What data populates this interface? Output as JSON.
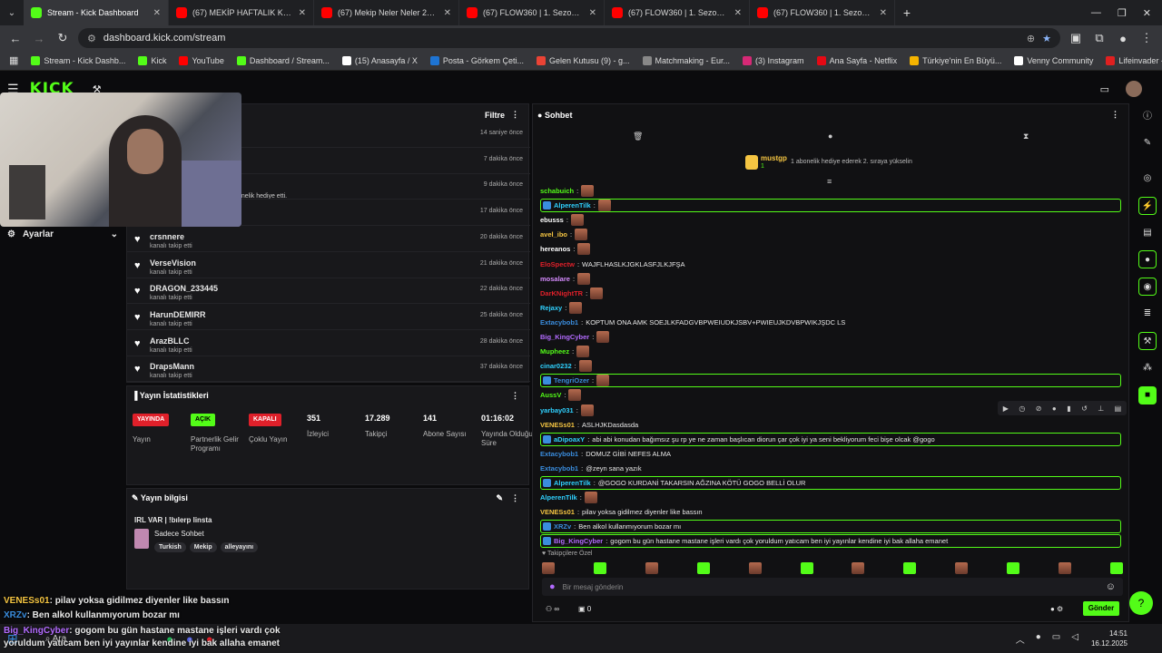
{
  "browser": {
    "tabs": [
      {
        "title": "Stream - Kick Dashboard",
        "color": "#53fc18"
      },
      {
        "title": "(67) MEKİP HAFTALIK KOMİK AN",
        "color": "#ff0000"
      },
      {
        "title": "(67) Mekip Neler Neler 26.bölü",
        "color": "#ff0000"
      },
      {
        "title": "(67) FLOW360 | 1. Sezon 6. Bölü",
        "color": "#ff0000"
      },
      {
        "title": "(67) FLOW360 | 1. Sezon 7. Bölü",
        "color": "#ff0000"
      },
      {
        "title": "(67) FLOW360 | 1. Sezon 8. Bölü",
        "color": "#ff0000"
      }
    ],
    "url": "dashboard.kick.com/stream",
    "bookmarks": [
      {
        "label": "Stream - Kick Dashb...",
        "color": "#53fc18"
      },
      {
        "label": "Kick",
        "color": "#53fc18"
      },
      {
        "label": "YouTube",
        "color": "#ff0000"
      },
      {
        "label": "Dashboard / Stream...",
        "color": "#53fc18"
      },
      {
        "label": "(15) Anasayfa / X",
        "color": "#ffffff"
      },
      {
        "label": "Posta - Görkem Çeti...",
        "color": "#1e74d3"
      },
      {
        "label": "Gelen Kutusu (9) - g...",
        "color": "#ea4335"
      },
      {
        "label": "Matchmaking - Eur...",
        "color": "#888888"
      },
      {
        "label": "(3) Instagram",
        "color": "#d62976"
      },
      {
        "label": "Ana Sayfa - Netflix",
        "color": "#e50914"
      },
      {
        "label": "Türkiye'nin En Büyü...",
        "color": "#f5b400"
      },
      {
        "label": "Venny Community",
        "color": "#ffffff"
      },
      {
        "label": "Lifeinvader - VennyV",
        "color": "#e02020"
      }
    ]
  },
  "kick": {
    "logo": "KICK",
    "settings_label": "Ayarlar"
  },
  "activity": {
    "filter_label": "Filtre",
    "partial_gift_text": "onelik hediye etti.",
    "rows": [
      {
        "name": "",
        "sub": "",
        "time": "14 saniye önce"
      },
      {
        "name": "",
        "sub": "",
        "time": "7 dakika önce"
      },
      {
        "name": "",
        "sub": "",
        "time": "9 dakika önce"
      },
      {
        "name": "",
        "sub": "",
        "time": "17 dakika önce"
      },
      {
        "name": "crsnnere",
        "sub": "kanalı takip etti",
        "time": "20 dakika önce"
      },
      {
        "name": "VerseVision",
        "sub": "kanalı takip etti",
        "time": "21 dakika önce"
      },
      {
        "name": "DRAGON_233445",
        "sub": "kanalı takip etti",
        "time": "22 dakika önce"
      },
      {
        "name": "HarunDEMIRR",
        "sub": "kanalı takip etti",
        "time": "25 dakika önce"
      },
      {
        "name": "ArazBLLC",
        "sub": "kanalı takip etti",
        "time": "28 dakika önce"
      },
      {
        "name": "DrapsMann",
        "sub": "kanalı takip etti",
        "time": "37 dakika önce"
      }
    ]
  },
  "stats": {
    "title": "Yayın İstatistikleri",
    "items": [
      {
        "badge": "YAYINDA",
        "label": "Yayın",
        "color": "#e0202a"
      },
      {
        "badge": "AÇIK",
        "label": "Partnerlik Gelir Programı",
        "color": "#53fc18"
      },
      {
        "badge": "KAPALI",
        "label": "Çoklu Yayın",
        "color": "#e0202a"
      },
      {
        "value": "351",
        "label": "İzleyici"
      },
      {
        "value": "17.289",
        "label": "Takipçi"
      },
      {
        "value": "141",
        "label": "Abone Sayısı"
      },
      {
        "value": "01:16:02",
        "label": "Yayında Olduğu Süre"
      }
    ]
  },
  "info": {
    "title": "Yayın bilgisi",
    "stream_title": "IRL VAR | !bılerp linsta",
    "category": "Sadece Sohbet",
    "tags": [
      "Turkish",
      "Mekip",
      "alleyayını"
    ]
  },
  "chat": {
    "title": "Sohbet",
    "pinned_user": "mustgp",
    "pinned_count": "1",
    "pinned_text": "1 abonelik hediye ederek 2. sıraya yükselin",
    "input_placeholder": "Bir mesaj gönderin",
    "send_label": "Gönder",
    "follower_only": "Takipçilere Özel",
    "footer_count": "0",
    "messages": [
      {
        "user": "schabuich",
        "color": "#53fc18",
        "text": "",
        "emote": true,
        "hl": false
      },
      {
        "user": "AlperenTilk",
        "color": "#2fd1ff",
        "text": "",
        "emote": true,
        "hl": true
      },
      {
        "user": "ebusss",
        "color": "#ffffff",
        "text": "",
        "emote": true,
        "hl": false
      },
      {
        "user": "avel_ibo",
        "color": "#f5c542",
        "text": "",
        "emote": true,
        "hl": false
      },
      {
        "user": "hereanos",
        "color": "#ffffff",
        "text": "",
        "emote": true,
        "hl": false
      },
      {
        "user": "EloSpectw",
        "color": "#e0202a",
        "text": "WAJFLHASLKJGKLASFJLKJFŞA",
        "emote": false,
        "hl": false
      },
      {
        "user": "mosalare",
        "color": "#d68cff",
        "text": "",
        "emote": true,
        "hl": false
      },
      {
        "user": "DarKNightTR",
        "color": "#e0202a",
        "text": "",
        "emote": true,
        "hl": false
      },
      {
        "user": "Rejaxy",
        "color": "#2fd1ff",
        "text": "",
        "emote": true,
        "hl": false
      },
      {
        "user": "Extacybob1",
        "color": "#3a8dde",
        "text": "KOPTUM ONA AMK SOEJLKFADGVBPWEIUDKJSBV+PWIEUJKDVBPWIKJŞDC LS",
        "emote": false,
        "hl": false
      },
      {
        "user": "Big_KingCyber",
        "color": "#b36bff",
        "text": "",
        "emote": true,
        "hl": false
      },
      {
        "user": "Mupheez",
        "color": "#53fc18",
        "text": "",
        "emote": true,
        "hl": false
      },
      {
        "user": "cinar0232",
        "color": "#2fd1ff",
        "text": "",
        "emote": true,
        "hl": false
      },
      {
        "user": "TengriOzer",
        "color": "#3a8dde",
        "text": "",
        "emote": true,
        "hl": true
      },
      {
        "user": "AussV",
        "color": "#53fc18",
        "text": "",
        "emote": true,
        "hl": false
      },
      {
        "user": "yarbay031",
        "color": "#2fd1ff",
        "text": "",
        "emote": true,
        "hl": false
      },
      {
        "user": "VENESs01",
        "color": "#f5c542",
        "text": "ASLHJKDasdasda",
        "emote": false,
        "hl": false
      },
      {
        "user": "aDipoaxY",
        "color": "#2fd1ff",
        "text": "abi abi konudan bağımsız şu rp ye ne zaman başlıcan diorun çar çok iyi ya seni bekliyorum feci bişe olcak @gogo",
        "emote": false,
        "hl": true
      },
      {
        "user": "Extacybob1",
        "color": "#3a8dde",
        "text": "DOMUZ GİBİ NEFES ALMA",
        "emote": false,
        "hl": false
      },
      {
        "user": "Extacybob1",
        "color": "#3a8dde",
        "text": "@zeyn sana yazık",
        "emote": false,
        "hl": false
      },
      {
        "user": "AlperenTilk",
        "color": "#2fd1ff",
        "text": "@GOGO KURDANİ TAKARSIN AĞZINA KÖTÜ GOGO BELLİ OLUR",
        "emote": false,
        "hl": true
      },
      {
        "user": "AlperenTilk",
        "color": "#2fd1ff",
        "text": "",
        "emote": true,
        "hl": false
      },
      {
        "user": "VENESs01",
        "color": "#f5c542",
        "text": "pilav yoksa gidilmez diyenler like bassın",
        "emote": false,
        "hl": false
      },
      {
        "user": "XRZv",
        "color": "#3a8dde",
        "text": "Ben alkol kullanmıyorum bozar mı",
        "emote": false,
        "hl": true
      },
      {
        "user": "Big_KingCyber",
        "color": "#b36bff",
        "text": "gogom bu gün hastane mastane işleri vardı çok yoruldum yatıcam ben iyi yayınlar kendine iyi bak allaha emanet",
        "emote": false,
        "hl": true
      }
    ]
  },
  "overlay": {
    "line1_user": "VENESs01",
    "line1_text": ": pilav yoksa gidilmez diyenler like bassın",
    "line2_user": "XRZv",
    "line2_text": ": Ben alkol kullanmıyorum bozar mı",
    "line3_user": "Big_KingCyber",
    "line3_text": ": gogom bu gün hastane mastane işleri vardı çok",
    "line4_text": "yoruldum yatıcam ben iyi yayınlar kendine iyi bak allaha emanet"
  },
  "taskbar": {
    "search_label": "Ara",
    "time": "14:51",
    "date": "16.12.2025"
  }
}
